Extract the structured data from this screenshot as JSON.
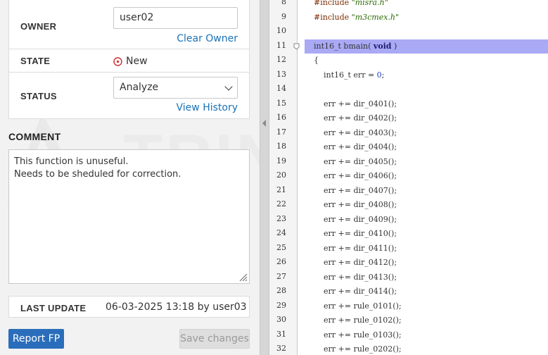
{
  "colors": {
    "accent": "#2a6ebb",
    "link": "#1a73b8",
    "highlight_line": "#a9a9f5",
    "state_icon": "#d03030"
  },
  "owner": {
    "label": "OWNER",
    "value": "user02",
    "clear_link": "Clear Owner"
  },
  "state": {
    "label": "STATE",
    "value": "New",
    "icon": "circle-dot-icon"
  },
  "status": {
    "label": "STATUS",
    "value": "Analyze",
    "history_link": "View History"
  },
  "comment": {
    "label": "COMMENT",
    "lines": [
      "This function is unuseful.",
      "Needs to be sheduled for correction."
    ]
  },
  "last_update": {
    "label": "LAST UPDATE",
    "value": "06-03-2025 13:18 by user03"
  },
  "buttons": {
    "report_fp": "Report FP",
    "save_changes": "Save changes"
  },
  "code": {
    "highlighted_line": "11",
    "lines": [
      {
        "n": "8",
        "text": "#include \"misra.h\""
      },
      {
        "n": "9",
        "text": "#include \"m3cmex.h\""
      },
      {
        "n": "10",
        "text": ""
      },
      {
        "n": "11",
        "text": "int16_t bmain( void )"
      },
      {
        "n": "12",
        "text": "{"
      },
      {
        "n": "13",
        "text": "    int16_t err = 0;"
      },
      {
        "n": "14",
        "text": ""
      },
      {
        "n": "15",
        "text": "    err += dir_0401();"
      },
      {
        "n": "16",
        "text": "    err += dir_0402();"
      },
      {
        "n": "17",
        "text": "    err += dir_0403();"
      },
      {
        "n": "18",
        "text": "    err += dir_0404();"
      },
      {
        "n": "19",
        "text": "    err += dir_0405();"
      },
      {
        "n": "20",
        "text": "    err += dir_0406();"
      },
      {
        "n": "21",
        "text": "    err += dir_0407();"
      },
      {
        "n": "22",
        "text": "    err += dir_0408();"
      },
      {
        "n": "23",
        "text": "    err += dir_0409();"
      },
      {
        "n": "24",
        "text": "    err += dir_0410();"
      },
      {
        "n": "25",
        "text": "    err += dir_0411();"
      },
      {
        "n": "26",
        "text": "    err += dir_0412();"
      },
      {
        "n": "27",
        "text": "    err += dir_0413();"
      },
      {
        "n": "28",
        "text": "    err += dir_0414();"
      },
      {
        "n": "29",
        "text": "    err += rule_0101();"
      },
      {
        "n": "30",
        "text": "    err += rule_0102();"
      },
      {
        "n": "31",
        "text": "    err += rule_0103();"
      },
      {
        "n": "32",
        "text": "    err += rule_0202();"
      }
    ]
  }
}
